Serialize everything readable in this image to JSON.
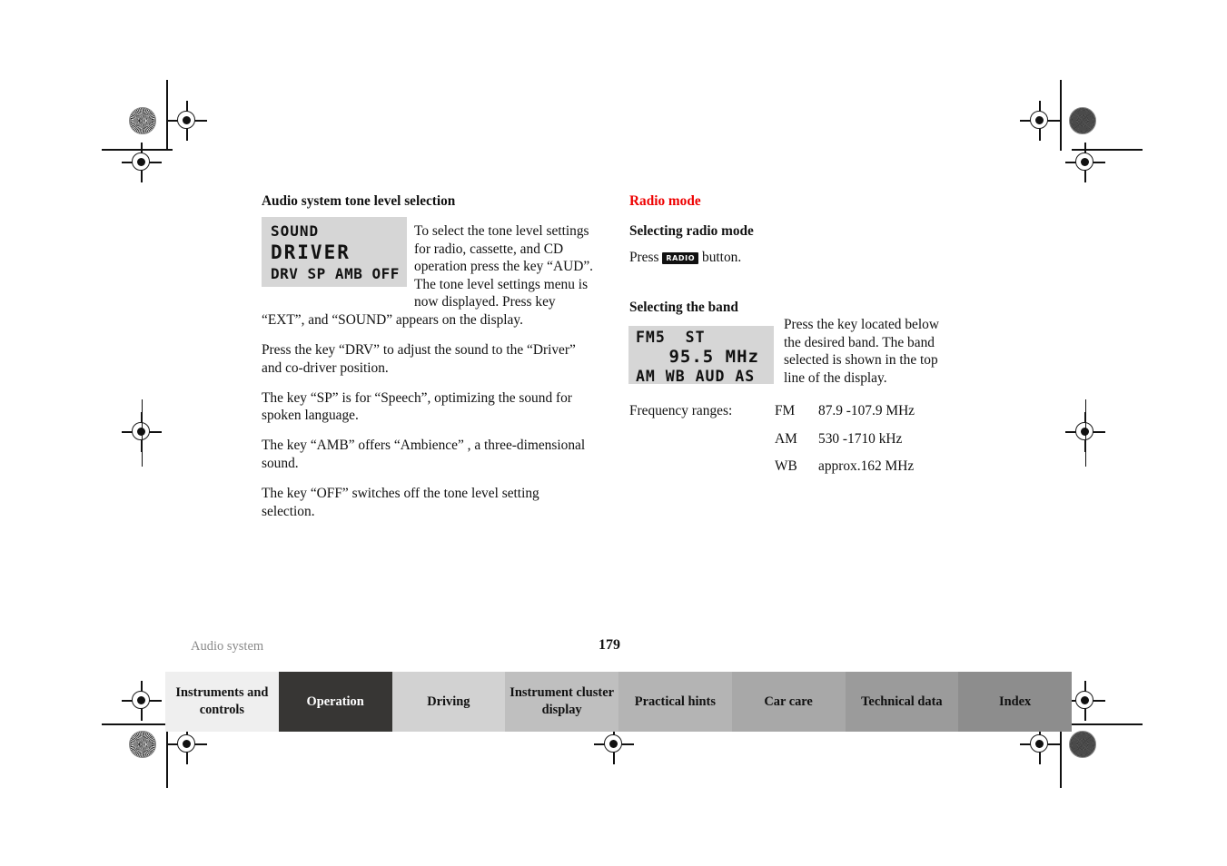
{
  "left_column": {
    "heading": "Audio system tone level selection",
    "lcd_sound": {
      "line1": "SOUND",
      "line2": "DRIVER",
      "line3": "DRV SP AMB OFF"
    },
    "paragraph_wrap": "To select the tone level settings for radio, cassette, and CD operation press the key “AUD”. The tone level settings menu is now displayed. Press key “EXT”, and “SOUND” appears on the display.",
    "paragraphs": [
      "Press the key “DRV” to adjust the sound to the “Driver” and co-driver position.",
      "The key “SP” is for “Speech”, optimizing the sound for spoken language.",
      "The key “AMB” offers “Ambience” , a three-dimensional sound.",
      "The key “OFF” switches off the tone level setting selection."
    ]
  },
  "right_column": {
    "section_heading": "Radio mode",
    "section_heading_color": "#ee0000",
    "sub_heading_1": "Selecting radio mode",
    "press_prefix": "Press",
    "radio_key_label": "RADIO",
    "press_suffix": "button.",
    "sub_heading_2": "Selecting the band",
    "lcd_radio": {
      "line1": "FM5  ST",
      "line2": "95.5 MHz",
      "line3": "AM WB AUD AS"
    },
    "band_paragraph": "Press the key located below the desired band. The band selected is shown in the top line of the display.",
    "frequency_label": "Frequency ranges:",
    "frequency_rows": [
      {
        "band": "FM",
        "range": "87.9 -107.9 MHz"
      },
      {
        "band": "AM",
        "range": "530 -1710 kHz"
      },
      {
        "band": "WB",
        "range": "approx.162 MHz"
      }
    ]
  },
  "footer": {
    "section_label": "Audio system",
    "page_number": "179"
  },
  "tabs": [
    {
      "label": "Instruments and controls",
      "bg": "#efefef",
      "color": "#111111"
    },
    {
      "label": "Operation",
      "bg": "#373634",
      "color": "#ffffff"
    },
    {
      "label": "Driving",
      "bg": "#d2d2d2",
      "color": "#111111"
    },
    {
      "label": "Instrument cluster display",
      "bg": "#bfbfbf",
      "color": "#111111"
    },
    {
      "label": "Practical hints",
      "bg": "#b4b4b4",
      "color": "#111111"
    },
    {
      "label": "Car care",
      "bg": "#a8a8a8",
      "color": "#111111"
    },
    {
      "label": "Technical data",
      "bg": "#9b9b9b",
      "color": "#111111"
    },
    {
      "label": "Index",
      "bg": "#8d8d8d",
      "color": "#111111"
    }
  ]
}
